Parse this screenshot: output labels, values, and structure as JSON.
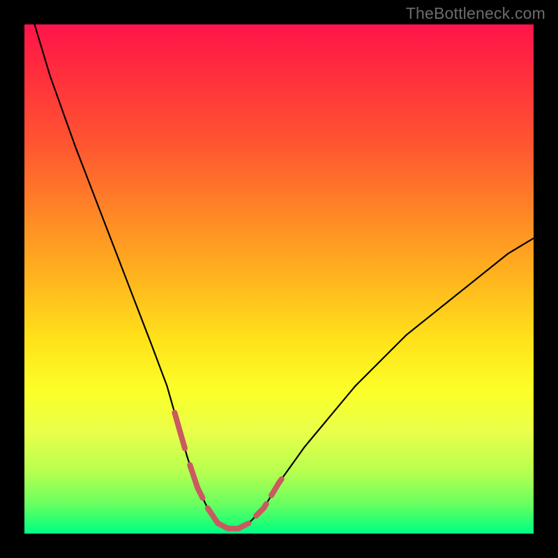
{
  "watermark": "TheBottleneck.com",
  "colors": {
    "dash": "#c95a5f",
    "line": "#000000"
  },
  "chart_data": {
    "type": "line",
    "title": "",
    "xlabel": "",
    "ylabel": "",
    "xlim": [
      0,
      100
    ],
    "ylim": [
      0,
      100
    ],
    "grid": false,
    "series": [
      {
        "name": "bottleneck-curve",
        "x": [
          2,
          5,
          10,
          15,
          20,
          25,
          28,
          30,
          32,
          34,
          36,
          38,
          40,
          42,
          44,
          47,
          50,
          55,
          60,
          65,
          70,
          75,
          80,
          85,
          90,
          95,
          100
        ],
        "values": [
          100,
          90,
          76,
          63,
          50,
          37,
          29,
          22,
          15,
          9,
          5,
          2,
          1,
          1,
          2,
          5,
          10,
          17,
          23,
          29,
          34,
          39,
          43,
          47,
          51,
          55,
          58
        ]
      }
    ],
    "annotations": [
      {
        "name": "dash-left-upper",
        "x_range": [
          29.5,
          31.5
        ],
        "note": "salmon dash segment on descending arm"
      },
      {
        "name": "dash-left-lower",
        "x_range": [
          32.5,
          35.0
        ],
        "note": "salmon dash segment on descending arm"
      },
      {
        "name": "dash-bottom",
        "x_range": [
          36.0,
          44.0
        ],
        "note": "salmon dash segment across trough"
      },
      {
        "name": "dash-right-lower",
        "x_range": [
          45.5,
          47.5
        ],
        "note": "salmon dash segment on ascending arm"
      },
      {
        "name": "dash-right-upper",
        "x_range": [
          48.5,
          50.5
        ],
        "note": "salmon dash segment on ascending arm"
      }
    ]
  }
}
